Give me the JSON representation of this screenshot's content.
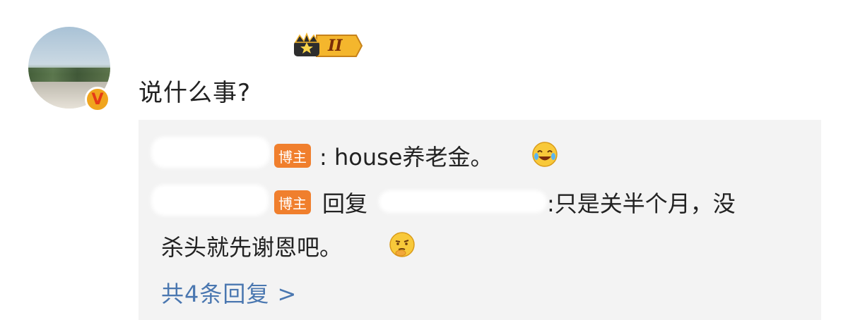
{
  "comment": {
    "avatar_icon": "user-avatar",
    "verified_badge": "V",
    "level_badge": "II",
    "text": "说什么事?"
  },
  "replies": [
    {
      "author_tag": "博主",
      "text": ": house养老金。",
      "emoji_icon": "laughing-crying-emoji-icon"
    },
    {
      "author_tag": "博主",
      "reply_word": "回复",
      "text_line1": ":只是关半个月，没",
      "text_line2": "杀头就先谢恩吧。",
      "emoji_icon": "thinking-emoji-icon"
    }
  ],
  "more_replies": "共4条回复 >",
  "colors": {
    "tag_bg": "#f07f2d",
    "link": "#4a77b0",
    "reply_bg": "#f3f3f3",
    "verified_badge": "#f0a51e"
  }
}
